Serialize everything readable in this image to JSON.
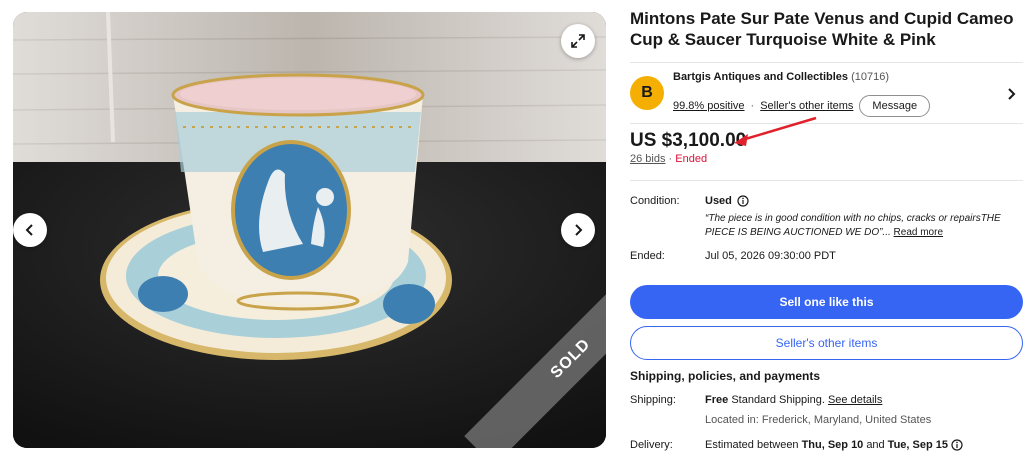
{
  "gallery": {
    "sold_label": "SOLD",
    "icons": {
      "prev": "chevron-left-icon",
      "next": "chevron-right-icon",
      "expand": "expand-icon"
    }
  },
  "listing": {
    "title": "Mintons Pate Sur Pate Venus and Cupid Cameo Cup & Saucer Turquoise White & Pink"
  },
  "seller": {
    "avatar_letter": "B",
    "name": "Bartgis Antiques and Collectibles",
    "count": "(10716)",
    "positive": "99.8% positive",
    "other_items": "Seller's other items",
    "message_button": "Message",
    "avatar_color": "#f5af02"
  },
  "price": {
    "amount": "US $3,100.00",
    "bids": "26 bids",
    "status": "Ended"
  },
  "details": {
    "condition_label": "Condition:",
    "condition_value": "Used",
    "condition_quote": "“The piece is in good condition with no chips, cracks or repairsTHE PIECE IS BEING AUCTIONED WE DO”...",
    "read_more": "Read more",
    "ended_label": "Ended:",
    "ended_value": "Jul 05, 2026 09:30:00 PDT"
  },
  "actions": {
    "sell_one": "Sell one like this",
    "other_items": "Seller's other items"
  },
  "shipping": {
    "section_title": "Shipping, policies, and payments",
    "shipping_label": "Shipping:",
    "shipping_free": "Free",
    "shipping_text": "Standard Shipping.",
    "see_details": "See details",
    "location": "Located in: Frederick, Maryland, United States",
    "delivery_label": "Delivery:",
    "delivery_prefix": "Estimated between",
    "delivery_start": "Thu, Sep 10",
    "delivery_and": "and",
    "delivery_end": "Tue, Sep 15"
  },
  "colors": {
    "primary": "#3665f3",
    "ended": "#e0103a",
    "annotation_arrow": "#e0202a"
  }
}
